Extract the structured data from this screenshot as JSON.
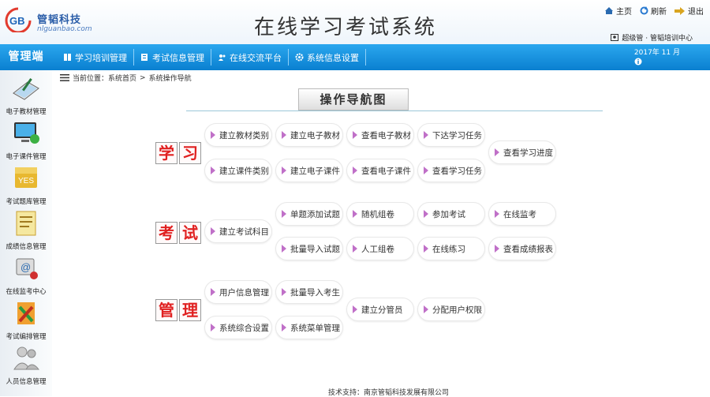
{
  "header": {
    "logo_text": "GB",
    "company_cn": "管韬科技",
    "company_en": "nlguanbao.com",
    "title": "在线学习考试系统",
    "links": [
      {
        "icon": "home-icon",
        "label": "主页"
      },
      {
        "icon": "refresh-icon",
        "label": "刷新"
      },
      {
        "icon": "logout-arrow-icon",
        "label": "退出"
      }
    ],
    "user": "超级管 · 管韬培训中心"
  },
  "nav": {
    "brand": "管理端",
    "items": [
      {
        "icon": "book-icon",
        "label": "学习培训管理"
      },
      {
        "icon": "exam-icon",
        "label": "考试信息管理"
      },
      {
        "icon": "chat-icon",
        "label": "在线交流平台"
      },
      {
        "icon": "gear-icon",
        "label": "系统信息设置"
      }
    ],
    "date": "2017年 11 月",
    "info_icon": "info-icon"
  },
  "sidebar": {
    "items": [
      {
        "icon": "textbook-icon",
        "label": "电子教材管理"
      },
      {
        "icon": "courseware-icon",
        "label": "电子课件管理"
      },
      {
        "icon": "question-bank-icon",
        "label": "考试题库管理"
      },
      {
        "icon": "score-sheet-icon",
        "label": "成绩信息管理"
      },
      {
        "icon": "online-exam-icon",
        "label": "在线监考中心"
      },
      {
        "icon": "exam-arrange-icon",
        "label": "考试编排管理"
      },
      {
        "icon": "users-icon",
        "label": "人员信息管理"
      }
    ]
  },
  "breadcrumb": {
    "prefix": "当前位置：系统首页",
    "current": "系统操作导航"
  },
  "main": {
    "title": "操作导航图",
    "sections": [
      {
        "chars": [
          "学",
          "习"
        ],
        "buttons": [
          "建立教材类别",
          "建立电子教材",
          "查看电子教材",
          "下达学习任务",
          "建立课件类别",
          "建立电子课件",
          "查看电子课件",
          "查看学习任务",
          "查看学习进度"
        ]
      },
      {
        "chars": [
          "考",
          "试"
        ],
        "buttons": [
          "建立考试科目",
          "单题添加试题",
          "随机组卷",
          "参加考试",
          "在线监考",
          "批量导入试题",
          "人工组卷",
          "在线练习",
          "查看成绩报表"
        ]
      },
      {
        "chars": [
          "管",
          "理"
        ],
        "buttons": [
          "用户信息管理",
          "批量导入考生",
          "建立分管员",
          "分配用户权限",
          "系统综合设置",
          "系统菜单管理"
        ]
      }
    ]
  },
  "footer": "技术支持：南京管韬科技发展有限公司"
}
